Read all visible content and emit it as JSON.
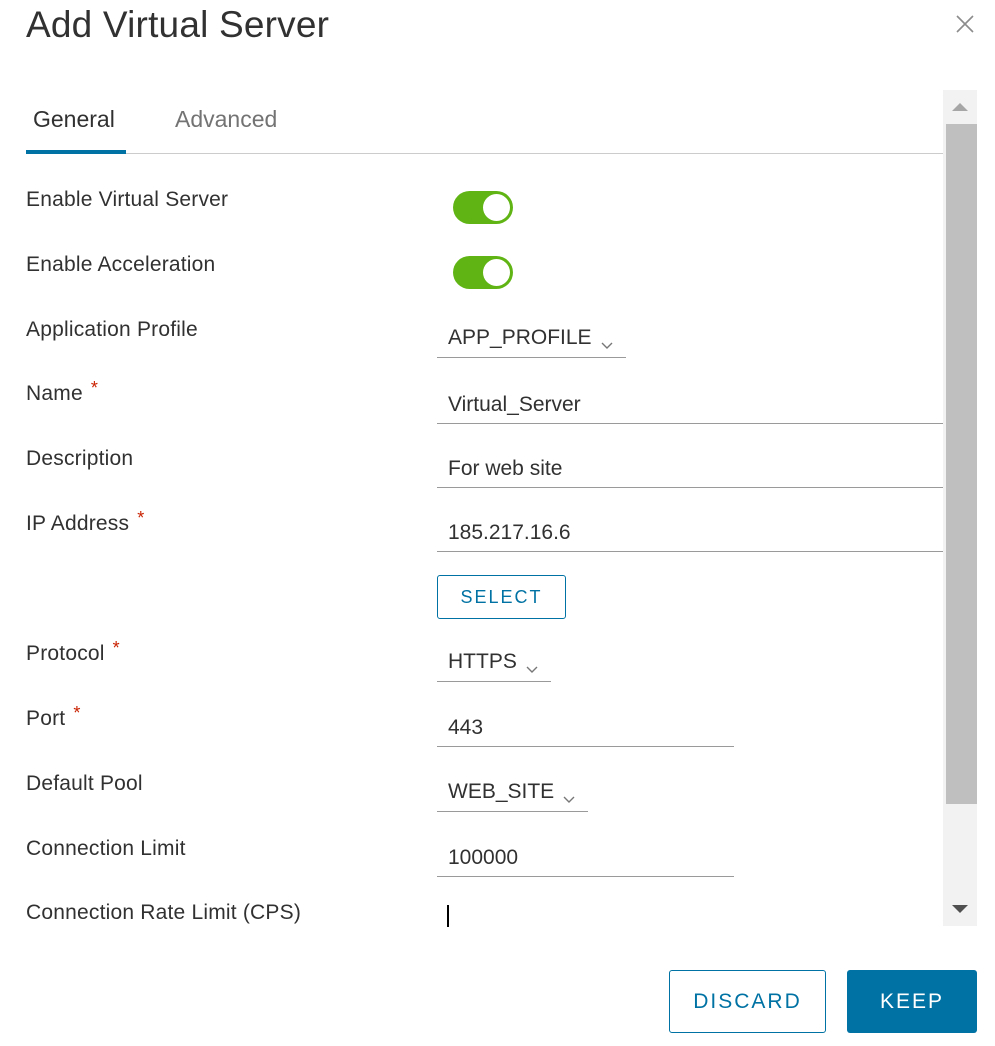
{
  "dialog": {
    "title": "Add Virtual Server",
    "close_icon": "close-icon"
  },
  "tabs": [
    {
      "label": "General",
      "active": true
    },
    {
      "label": "Advanced",
      "active": false
    }
  ],
  "fields": {
    "enable_virtual_server": {
      "label": "Enable Virtual Server",
      "value": true
    },
    "enable_acceleration": {
      "label": "Enable Acceleration",
      "value": true
    },
    "application_profile": {
      "label": "Application Profile",
      "value": "APP_PROFILE"
    },
    "name": {
      "label": "Name",
      "required": "*",
      "value": "Virtual_Server"
    },
    "description": {
      "label": "Description",
      "value": "For web site"
    },
    "ip_address": {
      "label": "IP Address",
      "required": "*",
      "value": "185.217.16.6",
      "select_label": "SELECT"
    },
    "protocol": {
      "label": "Protocol",
      "required": "*",
      "value": "HTTPS"
    },
    "port": {
      "label": "Port",
      "required": "*",
      "value": "443"
    },
    "default_pool": {
      "label": "Default Pool",
      "value": "WEB_SITE"
    },
    "connection_limit": {
      "label": "Connection Limit",
      "value": "100000"
    },
    "connection_rate_limit": {
      "label": "Connection Rate Limit (CPS)",
      "value": ""
    }
  },
  "footer": {
    "discard_label": "DISCARD",
    "keep_label": "KEEP"
  },
  "colors": {
    "accent": "#0072a3",
    "toggle_on": "#60b515",
    "required": "#c92100"
  }
}
